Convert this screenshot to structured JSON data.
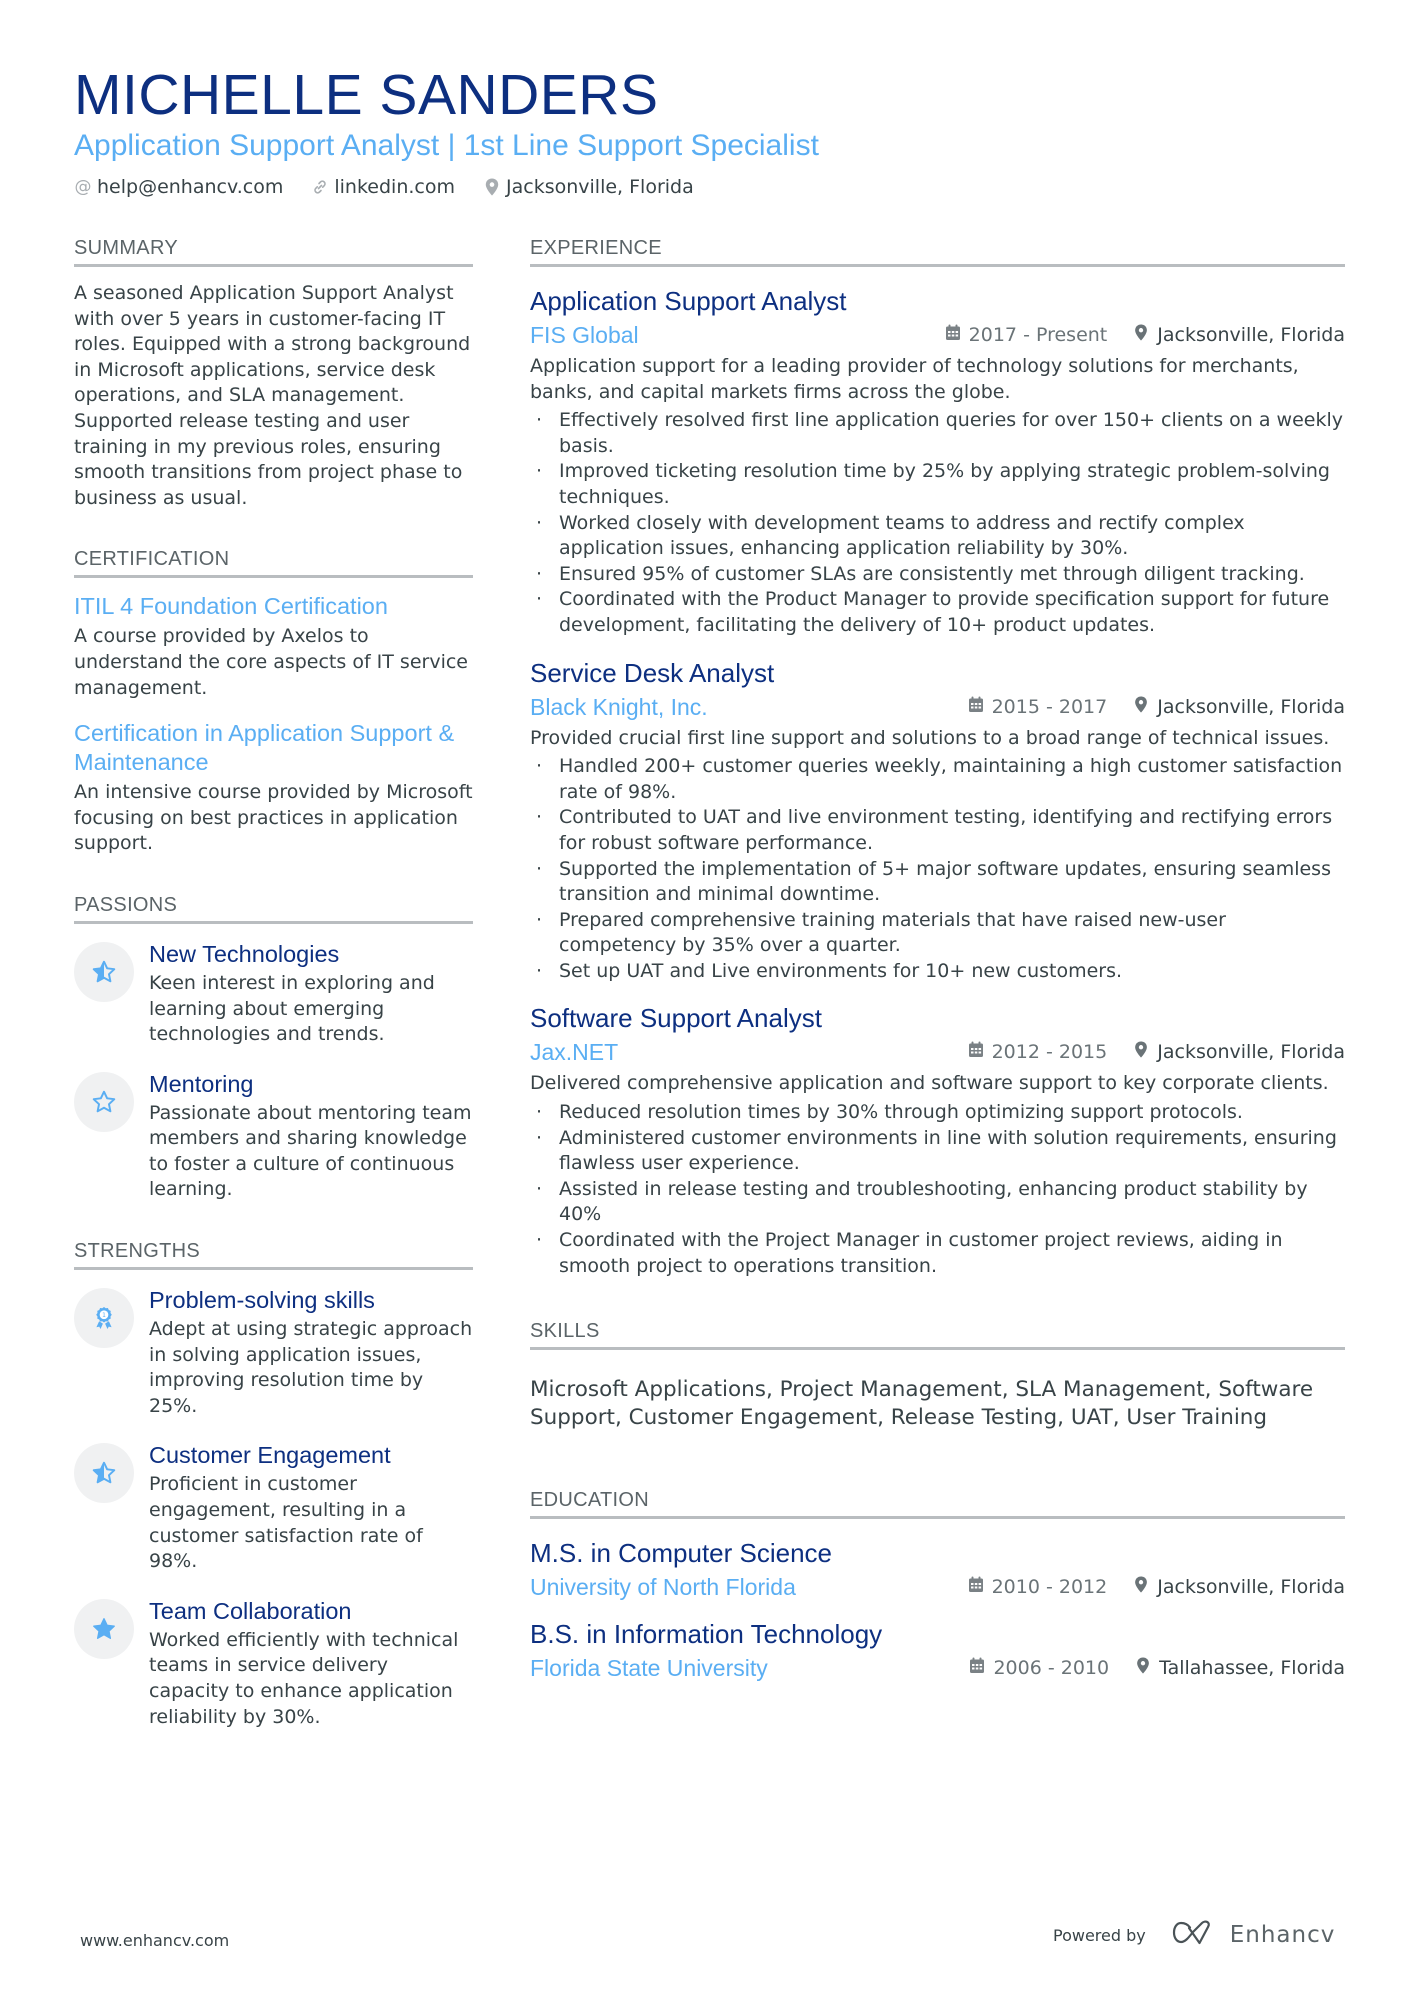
{
  "header": {
    "name": "MICHELLE SANDERS",
    "role": "Application Support Analyst | 1st Line Support Specialist",
    "contacts": [
      {
        "icon": "at-icon",
        "text": "help@enhancv.com"
      },
      {
        "icon": "link-icon",
        "text": "linkedin.com"
      },
      {
        "icon": "location-pin-icon",
        "text": "Jacksonville, Florida"
      }
    ]
  },
  "colors": {
    "primary": "#0d2f80",
    "accent": "#5aaef3",
    "text": "#384347",
    "rule": "#b9bdc0"
  },
  "summary": {
    "title": "SUMMARY",
    "text": "A seasoned Application Support Analyst with over 5 years in customer-facing IT roles. Equipped with a strong background in Microsoft applications, service desk operations, and SLA management. Supported release testing and user training in my previous roles, ensuring smooth transitions from project phase to business as usual."
  },
  "certification": {
    "title": "CERTIFICATION",
    "items": [
      {
        "title": "ITIL 4 Foundation Certification",
        "desc": "A course provided by Axelos to understand the core aspects of IT service management."
      },
      {
        "title": "Certification in Application Support & Maintenance",
        "desc": "An intensive course provided by Microsoft focusing on best practices in application support."
      }
    ]
  },
  "passions": {
    "title": "PASSIONS",
    "items": [
      {
        "icon": "half-star-icon",
        "title": "New Technologies",
        "desc": "Keen interest in exploring and learning about emerging technologies and trends."
      },
      {
        "icon": "star-outline-icon",
        "title": "Mentoring",
        "desc": "Passionate about mentoring team members and sharing knowledge to foster a culture of continuous learning."
      }
    ]
  },
  "strengths": {
    "title": "STRENGTHS",
    "items": [
      {
        "icon": "medal-icon",
        "title": "Problem-solving skills",
        "desc": "Adept at using strategic approach in solving application issues, improving resolution time by 25%."
      },
      {
        "icon": "half-star-icon",
        "title": "Customer Engagement",
        "desc": "Proficient in customer engagement, resulting in a customer satisfaction rate of 98%."
      },
      {
        "icon": "star-filled-icon",
        "title": "Team Collaboration",
        "desc": "Worked efficiently with technical teams in service delivery capacity to enhance application reliability by 30%."
      }
    ]
  },
  "experience": {
    "title": "EXPERIENCE",
    "jobs": [
      {
        "title": "Application Support Analyst",
        "company": "FIS Global",
        "dates": "2017 - Present",
        "location": "Jacksonville, Florida",
        "desc": "Application support for a leading provider of technology solutions for merchants, banks, and capital markets firms across the globe.",
        "bullets": [
          "Effectively resolved first line application queries for over 150+ clients on a weekly basis.",
          "Improved ticketing resolution time by 25% by applying strategic problem-solving techniques.",
          "Worked closely with development teams to address and rectify complex application issues, enhancing application reliability by 30%.",
          "Ensured 95% of customer SLAs are consistently met through diligent tracking.",
          "Coordinated with the Product Manager to provide specification support for future development, facilitating the delivery of 10+ product updates."
        ]
      },
      {
        "title": "Service Desk Analyst",
        "company": "Black Knight, Inc.",
        "dates": "2015 - 2017",
        "location": "Jacksonville, Florida",
        "desc": "Provided crucial first line support and solutions to a broad range of technical issues.",
        "bullets": [
          "Handled 200+ customer queries weekly, maintaining a high customer satisfaction rate of 98%.",
          "Contributed to UAT and live environment testing, identifying and rectifying errors for robust software performance.",
          "Supported the implementation of 5+ major software updates, ensuring seamless transition and minimal downtime.",
          "Prepared comprehensive training materials that have raised new-user competency by 35% over a quarter.",
          "Set up UAT and Live environments for 10+ new customers."
        ]
      },
      {
        "title": "Software Support Analyst",
        "company": "Jax.NET",
        "dates": "2012 - 2015",
        "location": "Jacksonville, Florida",
        "desc": "Delivered comprehensive application and software support to key corporate clients.",
        "bullets": [
          "Reduced resolution times by 30% through optimizing support protocols.",
          "Administered customer environments in line with solution requirements, ensuring flawless user experience.",
          "Assisted in release testing and troubleshooting, enhancing product stability by 40%",
          "Coordinated with the Project Manager in customer project reviews, aiding in smooth project to operations transition."
        ]
      }
    ]
  },
  "skills": {
    "title": "SKILLS",
    "text": "Microsoft Applications, Project Management, SLA Management, Software Support, Customer Engagement, Release Testing, UAT, User Training"
  },
  "education": {
    "title": "EDUCATION",
    "items": [
      {
        "degree": "M.S. in Computer Science",
        "school": "University of North Florida",
        "dates": "2010 - 2012",
        "location": "Jacksonville, Florida"
      },
      {
        "degree": "B.S. in Information Technology",
        "school": "Florida State University",
        "dates": "2006 - 2010",
        "location": "Tallahassee, Florida"
      }
    ]
  },
  "footer": {
    "website": "www.enhancv.com",
    "powered_by": "Powered by",
    "brand": "Enhancv"
  }
}
